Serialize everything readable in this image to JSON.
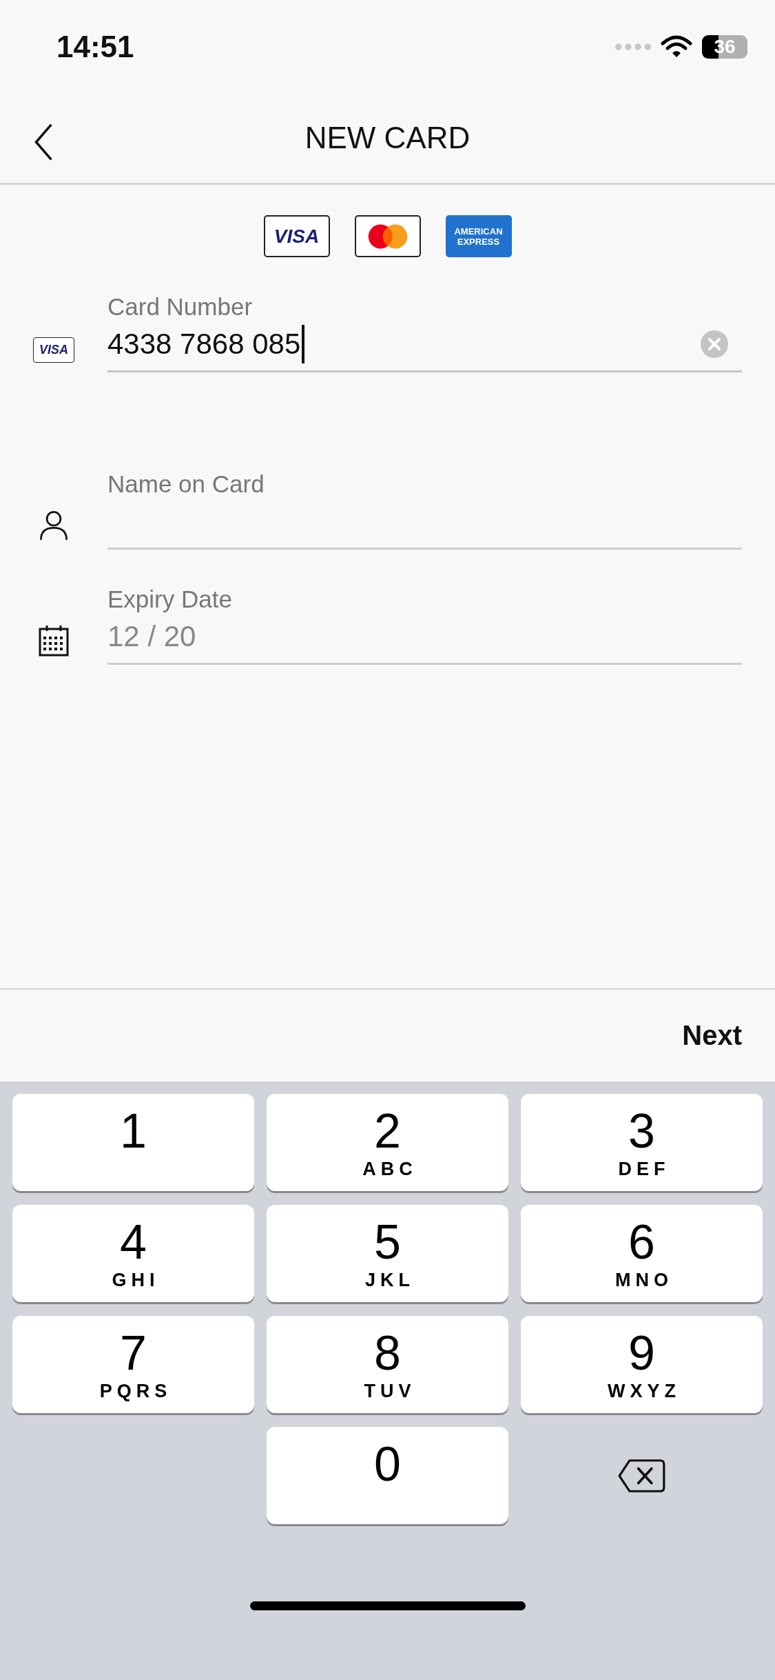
{
  "status_bar": {
    "time": "14:51",
    "battery": "36"
  },
  "nav": {
    "title": "NEW CARD"
  },
  "card_brands": [
    {
      "kind": "visa",
      "label": "VISA"
    },
    {
      "kind": "mastercard"
    },
    {
      "kind": "amex",
      "label": "AMERICAN EXPRESS"
    }
  ],
  "fields": [
    {
      "kind": "card",
      "label": "Card Number",
      "value": "4338 7868 085",
      "focused": true,
      "brand": "VISA"
    },
    {
      "kind": "person",
      "label": "Name on Card",
      "focused": false
    },
    {
      "kind": "calendar",
      "label": "Expiry Date",
      "placeholder": "12 / 20",
      "focused": false
    }
  ],
  "toolbar": {
    "next": "Next"
  },
  "keyboard": {
    "rows": [
      [
        {
          "kind": "digit",
          "digit": "1"
        },
        {
          "kind": "digit",
          "digit": "2",
          "letters": "ABC"
        },
        {
          "kind": "digit",
          "digit": "3",
          "letters": "DEF"
        }
      ],
      [
        {
          "kind": "digit",
          "digit": "4",
          "letters": "GHI"
        },
        {
          "kind": "digit",
          "digit": "5",
          "letters": "JKL"
        },
        {
          "kind": "digit",
          "digit": "6",
          "letters": "MNO"
        }
      ],
      [
        {
          "kind": "digit",
          "digit": "7",
          "letters": "PQRS"
        },
        {
          "kind": "digit",
          "digit": "8",
          "letters": "TUV"
        },
        {
          "kind": "digit",
          "digit": "9",
          "letters": "WXYZ"
        }
      ],
      [
        {
          "kind": "empty"
        },
        {
          "kind": "digit",
          "digit": "0"
        },
        {
          "kind": "delete"
        }
      ]
    ]
  }
}
